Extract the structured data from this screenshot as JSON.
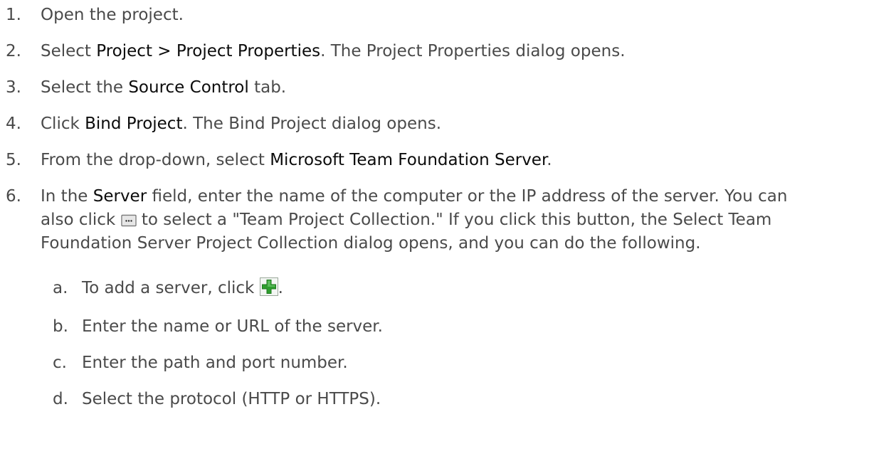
{
  "steps": [
    {
      "num": "1.",
      "text": "Open the project."
    },
    {
      "num": "2.",
      "pre": "Select ",
      "bold": "Project > Project Properties",
      "post": ". The Project Properties dialog opens."
    },
    {
      "num": "3.",
      "pre": "Select the ",
      "bold": "Source Control",
      "post": " tab."
    },
    {
      "num": "4.",
      "pre": "Click ",
      "bold": "Bind Project",
      "post": ". The Bind Project dialog opens."
    },
    {
      "num": "5.",
      "pre": "From the drop-down, select ",
      "bold": "Microsoft Team Foundation Server",
      "post": "."
    },
    {
      "num": "6.",
      "pre": "In the ",
      "bold": "Server",
      "mid": " field, enter the name of the computer or the IP address of the server. You can",
      "line2_pre": "also click ",
      "line2_post": " to select a \"Team Project Collection.\" If you click this button, the Select Team",
      "line3": "Foundation Server Project Collection dialog opens, and you can do the following."
    }
  ],
  "substeps": [
    {
      "num": "a.",
      "pre": "To add a server, click ",
      "post": "."
    },
    {
      "num": "b.",
      "text": "Enter the name or URL of the server."
    },
    {
      "num": "c.",
      "text": "Enter the path and port number."
    },
    {
      "num": "d.",
      "text": "Select the protocol (HTTP or HTTPS)."
    }
  ],
  "icons": {
    "browse": "ellipsis-browse-icon",
    "add": "green-plus-icon"
  },
  "colors": {
    "text": "#4a4a4a",
    "bold_text": "#0b0b0b",
    "add_icon_green": "#2e9e2e"
  }
}
